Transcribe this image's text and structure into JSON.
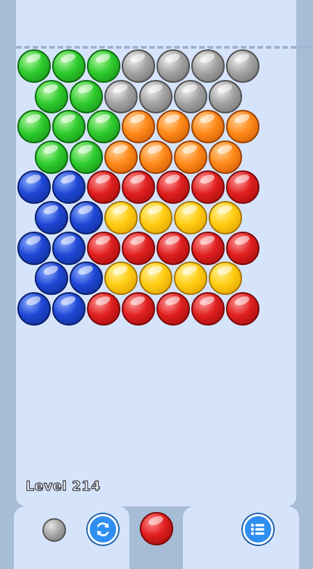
{
  "level": {
    "label": "Level 214"
  },
  "colors": {
    "green": "#2fcc2f",
    "gray": "#9a9a9a",
    "orange": "#ff8a1a",
    "blue": "#1f47d6",
    "red": "#e01f1f",
    "yellow": "#ffcc12"
  },
  "grid": {
    "rows": [
      [
        "green",
        "green",
        "green",
        "gray",
        "gray",
        "gray",
        "gray"
      ],
      [
        "green",
        "green",
        "gray",
        "gray",
        "gray",
        "gray"
      ],
      [
        "green",
        "green",
        "green",
        "orange",
        "orange",
        "orange",
        "orange"
      ],
      [
        "green",
        "green",
        "orange",
        "orange",
        "orange",
        "orange"
      ],
      [
        "blue",
        "blue",
        "red",
        "red",
        "red",
        "red",
        "red"
      ],
      [
        "blue",
        "blue",
        "yellow",
        "yellow",
        "yellow",
        "yellow"
      ],
      [
        "blue",
        "blue",
        "red",
        "red",
        "red",
        "red",
        "red"
      ],
      [
        "blue",
        "blue",
        "yellow",
        "yellow",
        "yellow",
        "yellow"
      ],
      [
        "blue",
        "blue",
        "red",
        "red",
        "red",
        "red",
        "red"
      ]
    ]
  },
  "shooter": {
    "next_bubble_color": "gray",
    "current_bubble_color": "red",
    "swap_icon": "refresh-icon",
    "menu_icon": "list-menu-icon"
  }
}
